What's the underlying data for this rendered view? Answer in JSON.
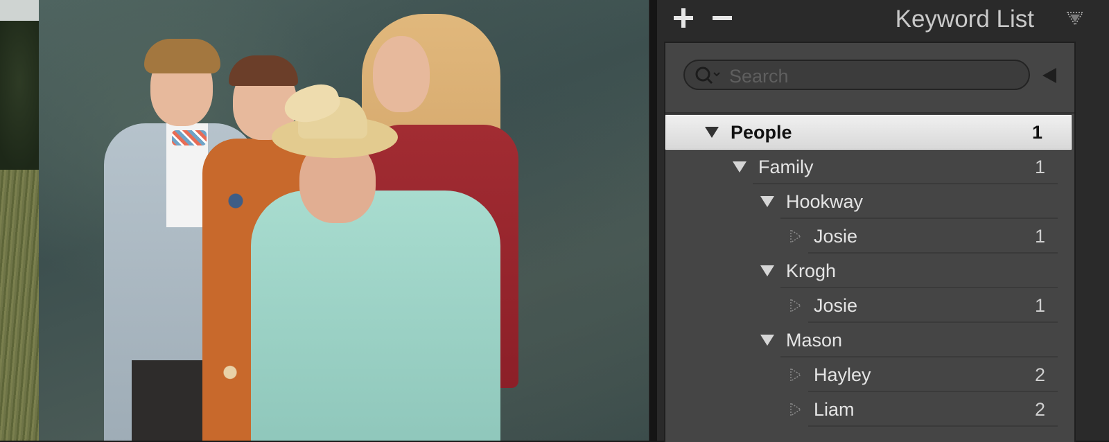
{
  "panel": {
    "title": "Keyword List",
    "add_icon": "plus-icon",
    "remove_icon": "minus-icon",
    "menu_icon": "panel-menu-triangle-icon"
  },
  "search": {
    "placeholder": "Search",
    "value": ""
  },
  "keywords": [
    {
      "label": "People",
      "count": "1",
      "level": 0,
      "expanded": true,
      "selected": true
    },
    {
      "label": "Family",
      "count": "1",
      "level": 1,
      "expanded": true,
      "selected": false
    },
    {
      "label": "Hookway",
      "count": "",
      "level": 2,
      "expanded": true,
      "selected": false
    },
    {
      "label": "Josie",
      "count": "1",
      "level": 3,
      "expanded": false,
      "selected": false
    },
    {
      "label": "Krogh",
      "count": "",
      "level": 2,
      "expanded": true,
      "selected": false
    },
    {
      "label": "Josie",
      "count": "1",
      "level": 3,
      "expanded": false,
      "selected": false
    },
    {
      "label": "Mason",
      "count": "",
      "level": 2,
      "expanded": true,
      "selected": false
    },
    {
      "label": "Hayley",
      "count": "2",
      "level": 3,
      "expanded": false,
      "selected": false
    },
    {
      "label": "Liam",
      "count": "2",
      "level": 3,
      "expanded": false,
      "selected": false
    }
  ],
  "colors": {
    "panel_bg": "#2a2a2a",
    "list_bg": "#454545",
    "selected_row": "#e6e6e6",
    "text": "#e4e4e4"
  }
}
